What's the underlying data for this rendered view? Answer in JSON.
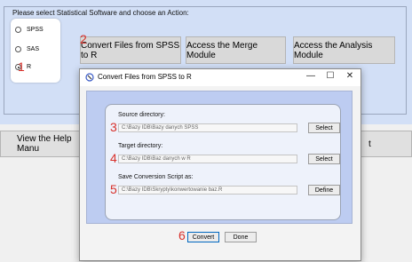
{
  "groupbox": {
    "title": "Please select Statistical Software and choose an Action:"
  },
  "radios": [
    {
      "label": "SPSS",
      "selected": false
    },
    {
      "label": "SAS",
      "selected": false
    },
    {
      "label": "R",
      "selected": true
    }
  ],
  "buttons": {
    "convert": "Convert Files from SPSS to R",
    "merge": "Access the Merge Module",
    "analysis": "Access the Analysis Module",
    "help": "View the Help Manu",
    "exit_fragment": "t"
  },
  "dialog": {
    "title": "Convert Files from SPSS to R",
    "controls": {
      "minimize": "—",
      "maximize": "☐",
      "close": "✕"
    },
    "source_label": "Source directory:",
    "source_path": "C:\\Bazy IDB\\Bazy danych SPSS",
    "target_label": "Target directory:",
    "target_path": "C:\\Bazy IDB\\Baz danych w R",
    "script_label": "Save Conversion Script as:",
    "script_path": "C:\\Bazy IDB\\Skrypty\\konwertowanie baz.R",
    "select_label": "Select",
    "define_label": "Define",
    "convert_label": "Convert",
    "done_label": "Done"
  },
  "annotations": [
    "1",
    "2",
    "3",
    "4",
    "5",
    "6"
  ],
  "colors": {
    "panel": "#d2dff6",
    "dialog_body": "#bdccf1",
    "annotation": "#d8302a",
    "focus_border": "#0067c0"
  }
}
